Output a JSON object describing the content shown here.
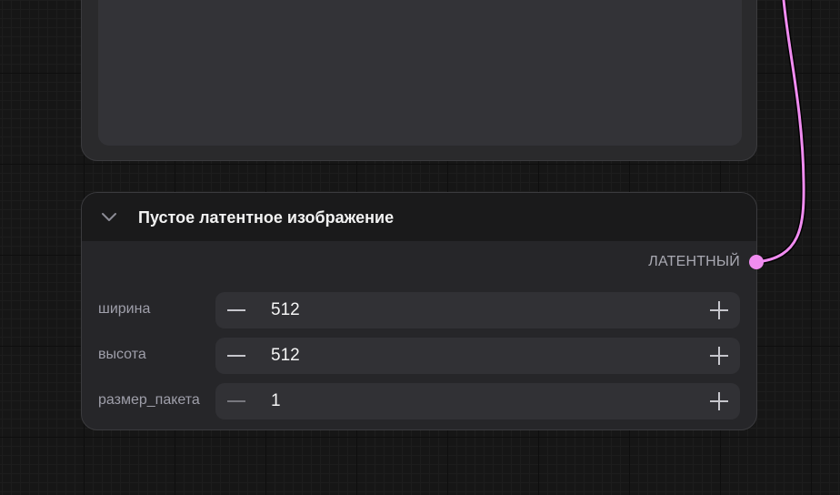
{
  "node": {
    "title": "Пустое латентное изображение",
    "output_label": "ЛАТЕНТНЫЙ",
    "output_color": "#f08cf0",
    "widgets": [
      {
        "label": "ширина",
        "value": "512"
      },
      {
        "label": "высота",
        "value": "512"
      },
      {
        "label": "размер_пакета",
        "value": "1"
      }
    ]
  },
  "icons": {
    "collapse": "chevron-down-icon",
    "decrement": "minus-icon",
    "increment": "plus-icon"
  }
}
